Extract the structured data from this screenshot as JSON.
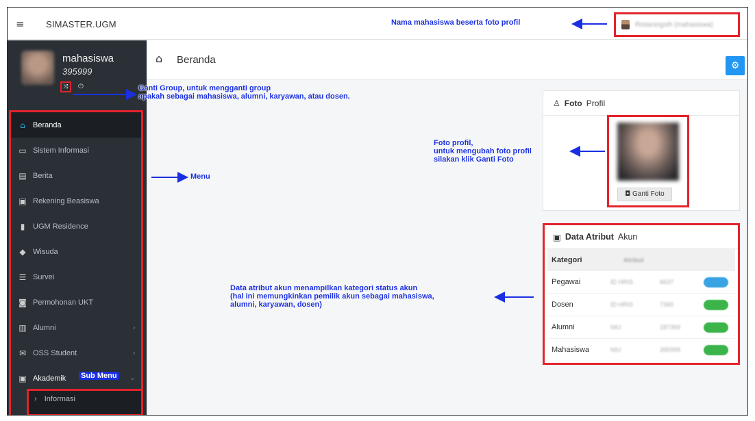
{
  "topbar": {
    "menu_icon": "≡",
    "brand": "SIMASTER.UGM",
    "user_label": "Ristaningsih (mahasiswa)"
  },
  "sidebar": {
    "user_role": "mahasiswa",
    "user_id": "395999",
    "group_icon": "⤨",
    "power_icon": "⏻",
    "items": [
      {
        "label": "Beranda",
        "icon": "home-icon"
      },
      {
        "label": "Sistem Informasi",
        "icon": "monitor-icon"
      },
      {
        "label": "Berita",
        "icon": "newspaper-icon"
      },
      {
        "label": "Rekening Beasiswa",
        "icon": "id-card-icon"
      },
      {
        "label": "UGM Residence",
        "icon": "building-icon"
      },
      {
        "label": "Wisuda",
        "icon": "graduation-cap-icon"
      },
      {
        "label": "Survei",
        "icon": "list-icon"
      },
      {
        "label": "Permohonan UKT",
        "icon": "money-icon"
      },
      {
        "label": "Alumni",
        "icon": "briefcase-icon"
      },
      {
        "label": "OSS Student",
        "icon": "envelope-icon"
      },
      {
        "label": "Akademik",
        "icon": "user-box-icon"
      }
    ],
    "submenu_item": "Informasi"
  },
  "main": {
    "page_title": "Beranda",
    "foto_card": {
      "title_bold": "Foto",
      "title_rest": "Profil",
      "button": "Ganti Foto"
    },
    "attr_card": {
      "title_bold": "Data Atribut",
      "title_rest": "Akun",
      "columns": [
        "Kategori",
        "Atribut"
      ],
      "rows": [
        {
          "kategori": "Pegawai",
          "a1": "ID HRIS",
          "a2": "6637",
          "pill_color": "#3aa3e3"
        },
        {
          "kategori": "Dosen",
          "a1": "ID HRIS",
          "a2": "7390",
          "pill_color": "#3bb54a"
        },
        {
          "kategori": "Alumni",
          "a1": "NIU",
          "a2": "187369",
          "pill_color": "#3bb54a"
        },
        {
          "kategori": "Mahasiswa",
          "a1": "NIU",
          "a2": "395999",
          "pill_color": "#3bb54a"
        }
      ]
    }
  },
  "annotations": {
    "user_note": "Nama mahasiswa beserta foto profil",
    "group_note_1": "Ganti Group, untuk mengganti group",
    "group_note_2": "apakah sebagai mahasiswa, alumni, karyawan, atau dosen.",
    "menu_note": "Menu",
    "foto_note_1": "Foto profil,",
    "foto_note_2": "untuk mengubah foto profil",
    "foto_note_3": "silakan klik Ganti Foto",
    "attr_note_1": "Data atribut akun menampilkan kategori status akun",
    "attr_note_2": "(hal ini memungkinkan pemilik akun sebagai mahasiswa,",
    "attr_note_3": "alumni, karyawan, dosen)",
    "submenu_note": "Sub Menu"
  },
  "colors": {
    "highlight": "#e3232b",
    "annotation": "#1a2fe0",
    "sidebar_bg": "#2a3036",
    "accent": "#2196f3"
  }
}
